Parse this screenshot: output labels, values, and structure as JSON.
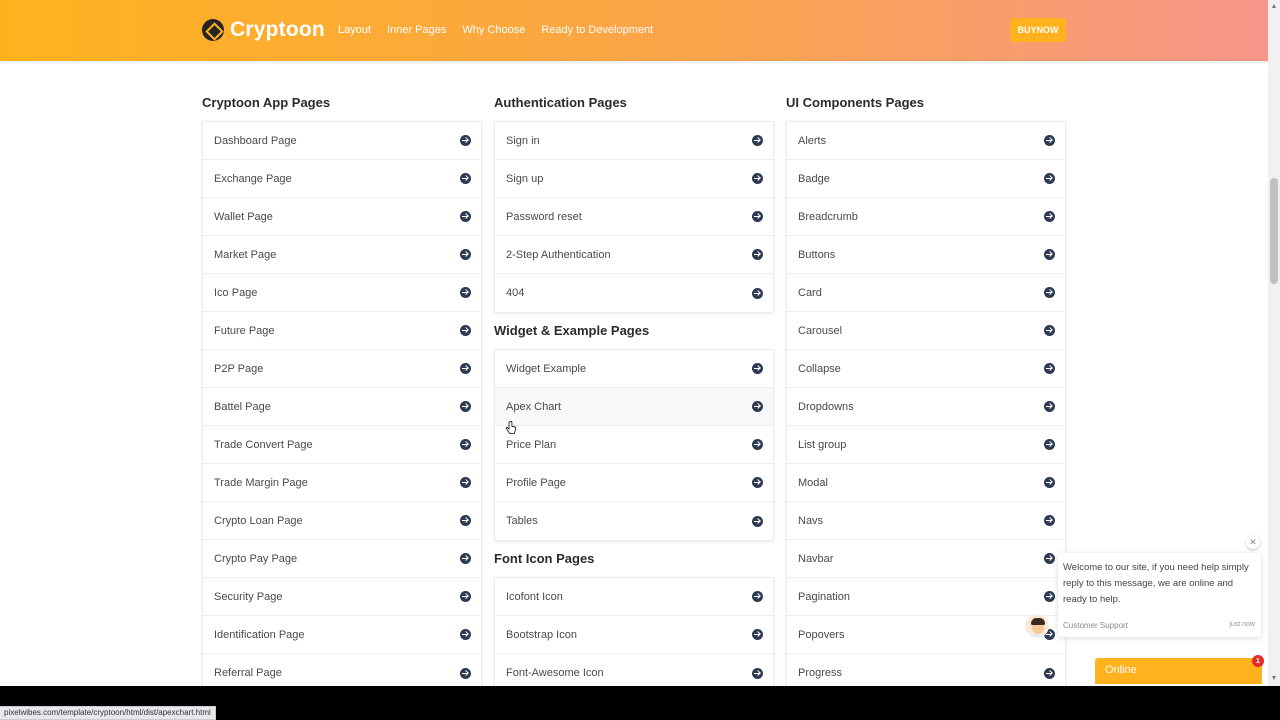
{
  "header": {
    "brand": "Cryptoon",
    "nav": [
      "Layout",
      "Inner Pages",
      "Why Choose",
      "Ready to Development"
    ],
    "buy_label": "BUYNOW"
  },
  "columns": {
    "app": {
      "title": "Cryptoon App Pages",
      "items": [
        "Dashboard Page",
        "Exchange Page",
        "Wallet Page",
        "Market Page",
        "Ico Page",
        "Future Page",
        "P2P Page",
        "Battel Page",
        "Trade Convert Page",
        "Trade Margin Page",
        "Crypto Loan Page",
        "Crypto Pay Page",
        "Security Page",
        "Identification Page",
        "Referral Page"
      ]
    },
    "auth": {
      "title": "Authentication Pages",
      "items": [
        "Sign in",
        "Sign up",
        "Password reset",
        "2-Step Authentication",
        "404"
      ]
    },
    "widget": {
      "title": "Widget & Example Pages",
      "items": [
        "Widget Example",
        "Apex Chart",
        "Price Plan",
        "Profile Page",
        "Tables"
      ]
    },
    "icons": {
      "title": "Font Icon Pages",
      "items": [
        "Icofont Icon",
        "Bootstrap Icon",
        "Font-Awesome Icon"
      ]
    },
    "ui": {
      "title": "UI Components Pages",
      "items": [
        "Alerts",
        "Badge",
        "Breadcrumb",
        "Buttons",
        "Card",
        "Carousel",
        "Collapse",
        "Dropdowns",
        "List group",
        "Modal",
        "Navs",
        "Navbar",
        "Pagination",
        "Popovers",
        "Progress"
      ]
    }
  },
  "chat": {
    "message": "Welcome to our site, if you need help simply reply to this message, we are online and ready to help.",
    "sender": "Customer Support",
    "time": "just now",
    "status": "Online",
    "badge": "1"
  },
  "status_url": "pixelwibes.com/template/cryptoon/html/dist/apexchart.html",
  "hovered_item": "Apex Chart",
  "colors": {
    "accent": "#ffb21e",
    "header_gradient_end": "#f7958a",
    "arrow_icon": "#2e3a52"
  }
}
